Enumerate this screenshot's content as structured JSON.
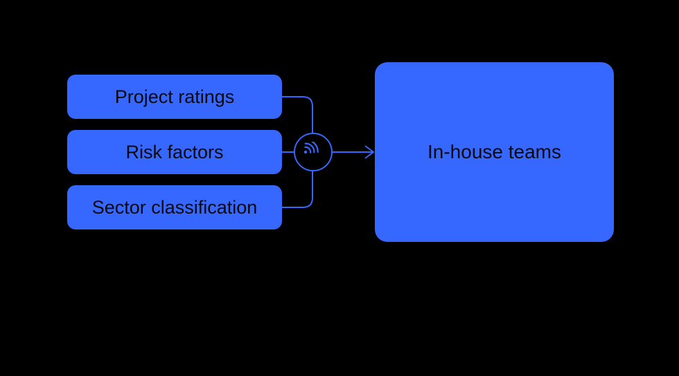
{
  "colors": {
    "accent": "#3667fe",
    "bg": "#000000",
    "text": "#0a0a0a"
  },
  "inputs": [
    {
      "label": "Project ratings"
    },
    {
      "label": "Risk factors"
    },
    {
      "label": "Sector classification"
    }
  ],
  "node": {
    "icon": "signal-icon"
  },
  "output": {
    "label": "In-house teams"
  }
}
